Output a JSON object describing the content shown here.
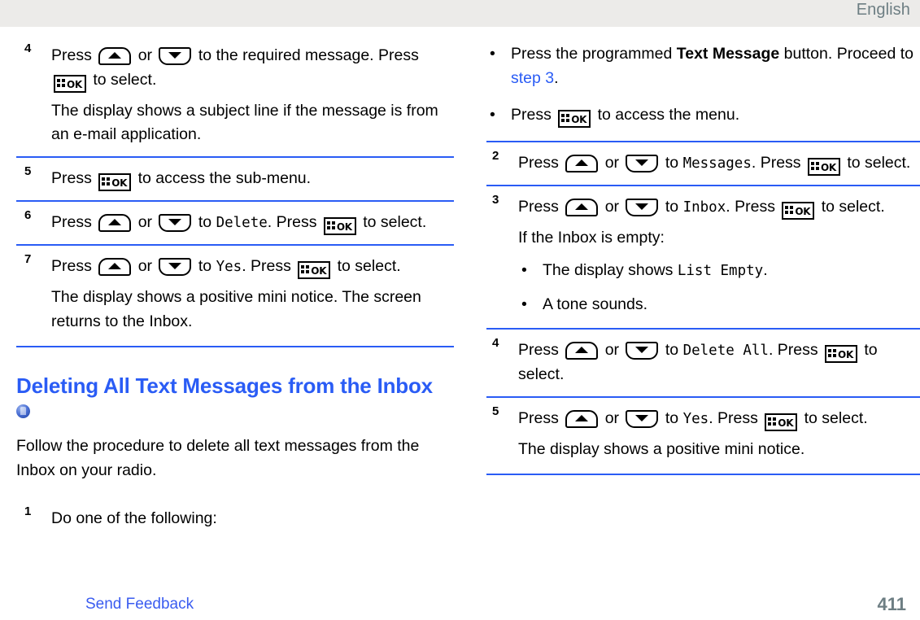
{
  "header": {
    "language": "English"
  },
  "footer": {
    "feedback_link": "Send Feedback",
    "page_number": "411"
  },
  "colors": {
    "accent_blue": "#2a5cf5",
    "link_blue": "#3a5cf0",
    "header_gray": "#6d7e83",
    "header_band": "#ecebe9",
    "separator_dark": "#3a3f45"
  },
  "icons": {
    "nav_up": "nav-up-button-icon",
    "nav_down": "nav-down-button-icon",
    "menu_ok": "menu-ok-button-icon",
    "radio_badge": "radio-badge-icon"
  },
  "left_column": {
    "step4": {
      "number": "4",
      "line1_a": "Press",
      "line1_b": "or",
      "line1_c": "to the required message. Press",
      "line1_d": "to select.",
      "result": "The display shows a subject line if the message is from an e-mail application."
    },
    "step5": {
      "number": "5",
      "text_a": "Press",
      "text_b": "to access the sub-menu."
    },
    "step6": {
      "number": "6",
      "text_a": "Press",
      "text_b": "or",
      "text_c": "to",
      "target": "Delete",
      "text_d": ". Press",
      "text_e": "to select."
    },
    "step7": {
      "number": "7",
      "text_a": "Press",
      "text_b": "or",
      "text_c": "to",
      "target": "Yes",
      "text_d": ". Press",
      "text_e": "to select.",
      "result": "The display shows a positive mini notice. The screen returns to the Inbox."
    },
    "section": {
      "heading": "Deleting All Text Messages from the Inbox",
      "intro": "Follow the procedure to delete all text messages from the Inbox on your radio.",
      "step1": {
        "number": "1",
        "text": "Do one of the following:"
      }
    }
  },
  "right_column": {
    "bullets_top": [
      {
        "dot": "•",
        "text_a": "Press the programmed",
        "bold": "Text Message",
        "text_b": "button. Proceed to",
        "link": "step 3",
        "text_c": "."
      },
      {
        "dot": "•",
        "text_a": "Press",
        "text_b": "to access the menu."
      }
    ],
    "step2": {
      "number": "2",
      "text_a": "Press",
      "text_b": "or",
      "text_c": "to",
      "target": "Messages",
      "text_d": ". Press",
      "text_e": "to select."
    },
    "step3": {
      "number": "3",
      "text_a": "Press",
      "text_b": "or",
      "text_c": "to",
      "target": "Inbox",
      "text_d": ". Press",
      "text_e": "to select.",
      "condition": "If the Inbox is empty:",
      "sub_bullets": [
        {
          "dot": "•",
          "text_a": "The display shows",
          "target": "List Empty",
          "text_b": "."
        },
        {
          "dot": "•",
          "text_a": "A tone sounds."
        }
      ]
    },
    "step4": {
      "number": "4",
      "text_a": "Press",
      "text_b": "or",
      "text_c": "to",
      "target": "Delete All",
      "text_d": ". Press",
      "text_e": "to select."
    },
    "step5": {
      "number": "5",
      "text_a": "Press",
      "text_b": "or",
      "text_c": "to",
      "target": "Yes",
      "text_d": ". Press",
      "text_e": "to select.",
      "result": "The display shows a positive mini notice."
    }
  }
}
